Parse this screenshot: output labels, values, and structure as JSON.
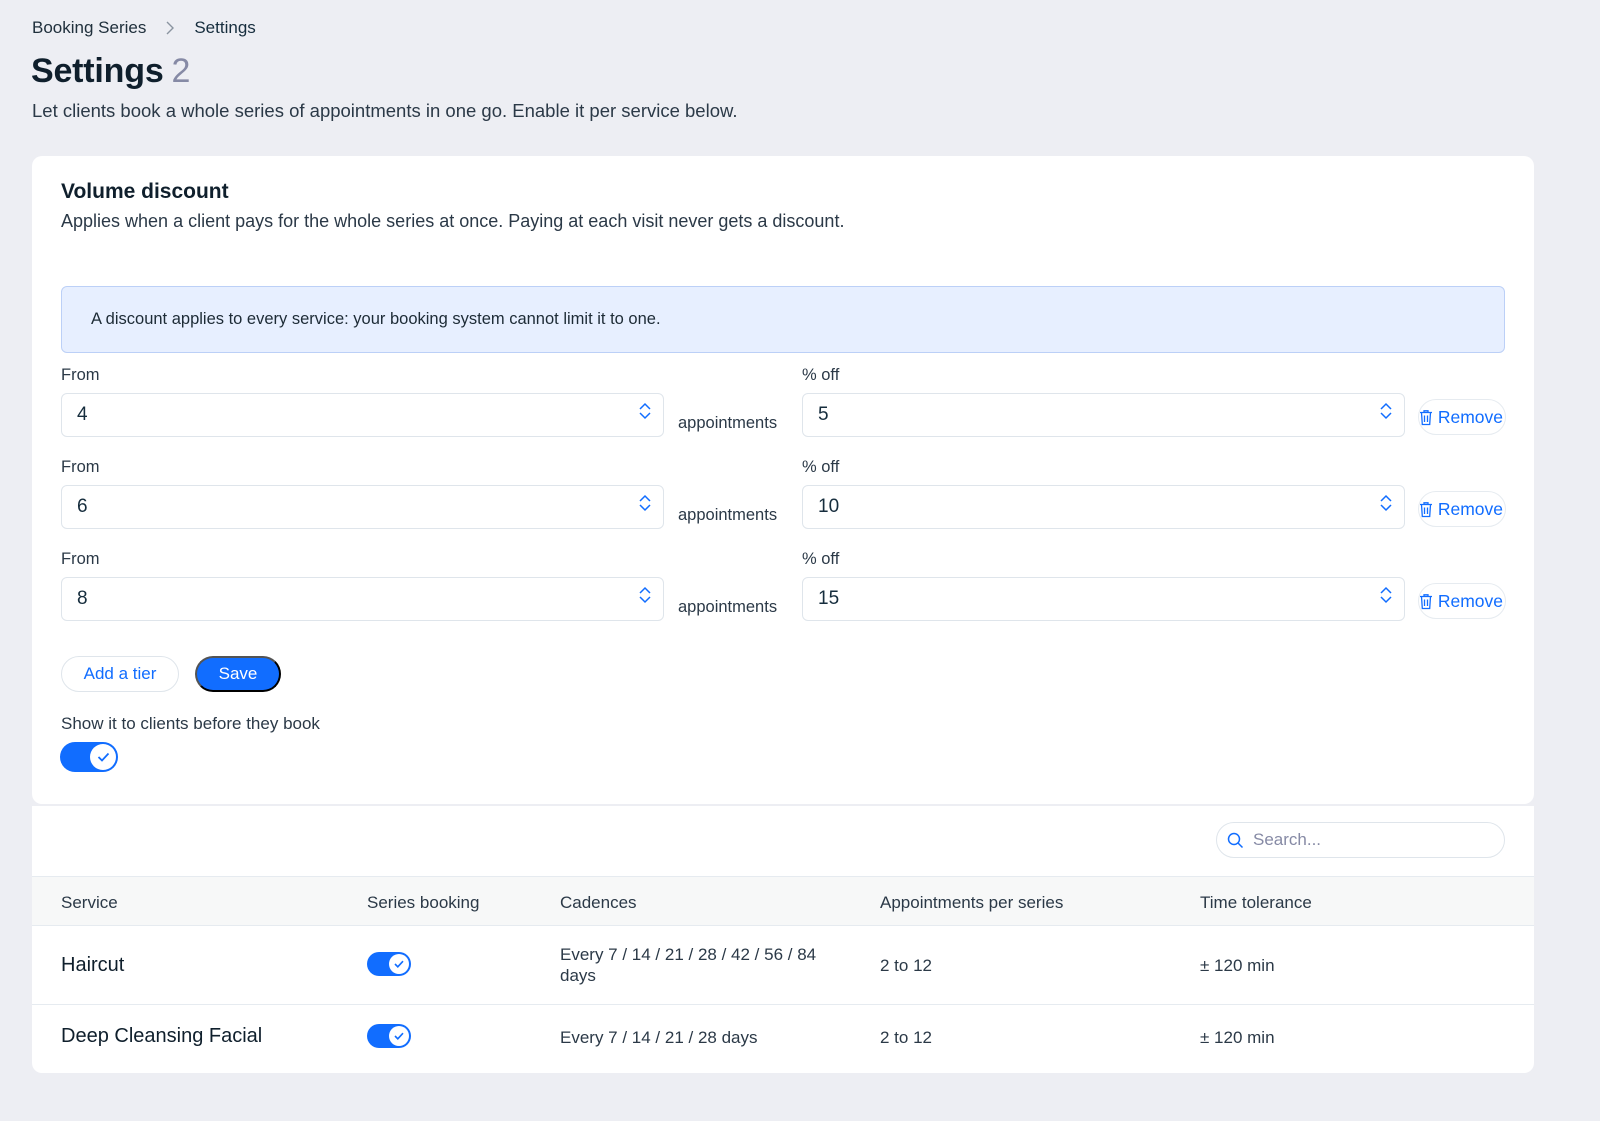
{
  "breadcrumb": {
    "parent": "Booking Series",
    "current": "Settings"
  },
  "header": {
    "title": "Settings",
    "count": "2",
    "subtitle": "Let clients book a whole series of appointments in one go. Enable it per service below."
  },
  "discount": {
    "title": "Volume discount",
    "description": "Applies when a client pays for the whole series at once. Paying at each visit never gets a discount.",
    "notice": "A discount applies to every service: your booking system cannot limit it to one.",
    "from_label": "From",
    "off_label": "% off",
    "unit_label": "appointments",
    "remove_label": "Remove",
    "tiers": [
      {
        "from": "4",
        "off": "5"
      },
      {
        "from": "6",
        "off": "10"
      },
      {
        "from": "8",
        "off": "15"
      }
    ],
    "add_tier_label": "Add a tier",
    "save_label": "Save",
    "show_label": "Show it to clients before they book",
    "show_enabled": true
  },
  "table": {
    "search_placeholder": "Search...",
    "columns": [
      "Service",
      "Series booking",
      "Cadences",
      "Appointments per series",
      "Time tolerance"
    ],
    "rows": [
      {
        "service": "Haircut",
        "enabled": true,
        "cadences": "Every 7 / 14 / 21 / 28 / 42 / 56 / 84 days",
        "appointments": "2 to 12",
        "tolerance": "± 120 min"
      },
      {
        "service": "Deep Cleansing Facial",
        "enabled": true,
        "cadences": "Every 7 / 14 / 21 / 28 days",
        "appointments": "2 to 12",
        "tolerance": "± 120 min"
      }
    ]
  },
  "colors": {
    "accent": "#116dff",
    "background": "#edeef3",
    "notice_bg": "#e7efff"
  }
}
